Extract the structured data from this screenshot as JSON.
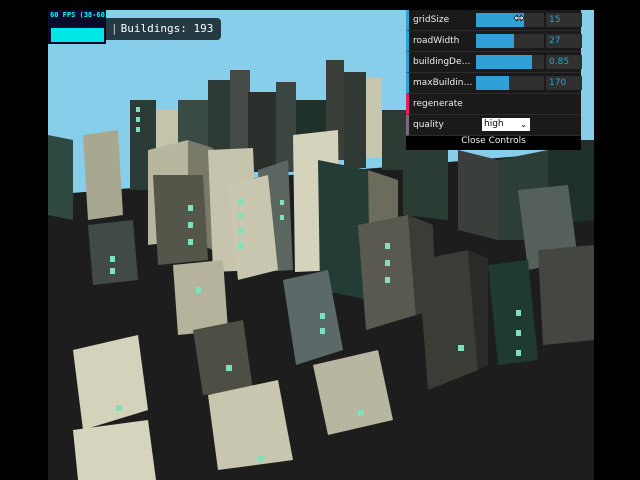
{
  "stats": {
    "fps_text": "60 FPS (38-60)"
  },
  "counter": {
    "label": "Buildings:",
    "count": "193"
  },
  "controls": {
    "sliders": [
      {
        "label": "gridSize",
        "value": "15",
        "fraction": 0.7
      },
      {
        "label": "roadWidth",
        "value": "27",
        "fraction": 0.56
      },
      {
        "label": "buildingDensity",
        "value": "0.85",
        "fraction": 0.83
      },
      {
        "label": "maxBuildingHe...",
        "value": "170",
        "fraction": 0.48
      }
    ],
    "regenerate_label": "regenerate",
    "quality_label": "quality",
    "quality_value": "high",
    "close_label": "Close Controls"
  },
  "colors": {
    "sky": "#87ceeb",
    "ground": "#1c1c1c",
    "slider_accent": "#2fa1d6",
    "button_accent": "#e61d5f",
    "window_glow": "#7fe0c0"
  },
  "icons": {
    "slider_cursor": "resize-horizontal-icon",
    "dropdown": "chevron-down-icon"
  }
}
